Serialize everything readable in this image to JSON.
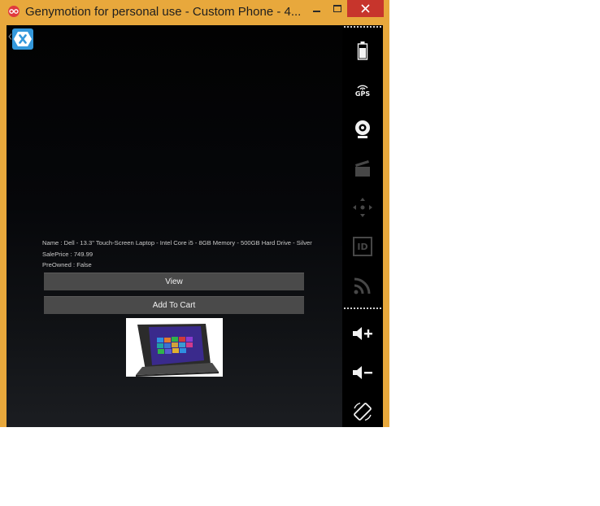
{
  "window": {
    "title": "Genymotion for personal use - Custom Phone - 4...",
    "frame_color": "#e8a83c",
    "close_color": "#c7352c"
  },
  "product": {
    "name_line": "Name : Dell - 13.3\" Touch-Screen Laptop - Intel Core i5 - 8GB Memory - 500GB Hard Drive - Silver",
    "price_line": "SalePrice : 749.99",
    "preowned_line": "PreOwned : False",
    "image_icon": "laptop-product-image"
  },
  "buttons": {
    "view": "View",
    "add_to_cart": "Add To Cart"
  },
  "sidebar": {
    "gps_label": "GPS",
    "id_label": "ID",
    "icons": [
      "battery-icon",
      "gps-icon",
      "webcam-icon",
      "clapperboard-icon",
      "dpad-icon",
      "id-icon",
      "rss-icon",
      "volume-up-icon",
      "volume-down-icon",
      "rotate-icon"
    ]
  }
}
